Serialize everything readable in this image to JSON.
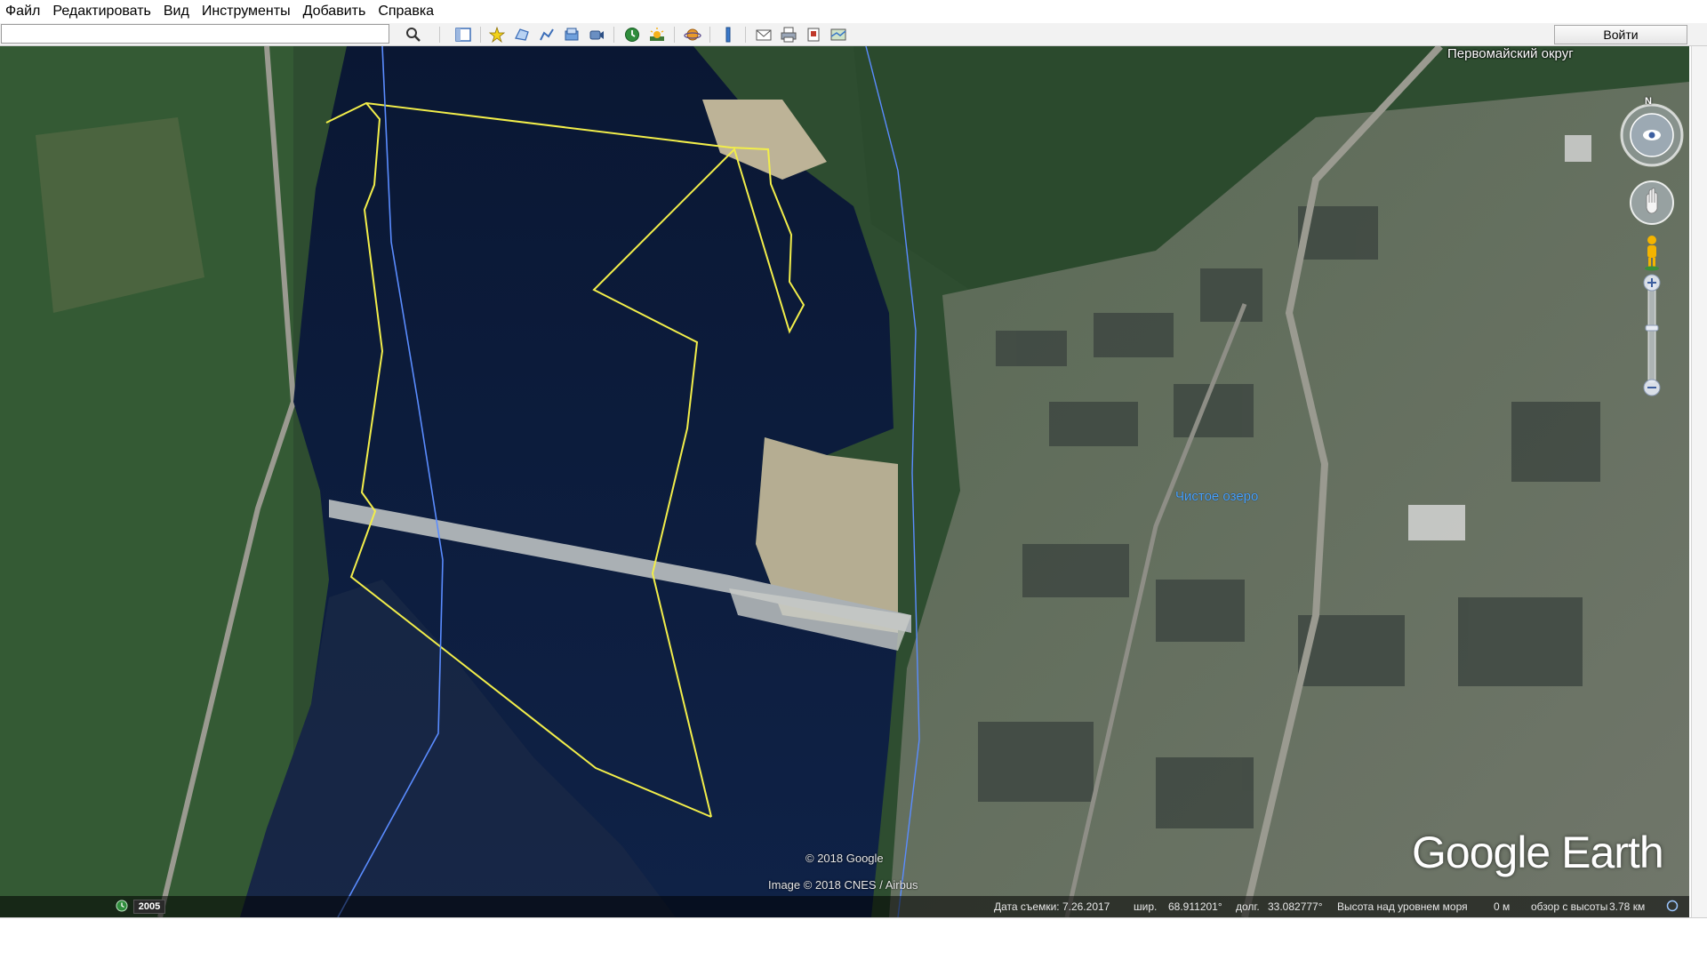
{
  "menu": {
    "items": [
      "Файл",
      "Редактировать",
      "Вид",
      "Инструменты",
      "Добавить",
      "Справка"
    ]
  },
  "toolbar": {
    "search_value": "",
    "login_label": "Войти",
    "icons": [
      "search-icon",
      "sidebar-icon",
      "placemark-icon",
      "polygon-icon",
      "path-icon",
      "overlay-icon",
      "tour-icon",
      "history-icon",
      "sun-icon",
      "planet-icon",
      "ruler-icon",
      "email-icon",
      "print-icon",
      "save-image-icon",
      "maps-icon"
    ]
  },
  "map": {
    "labels": {
      "district": "Первомайский округ",
      "lake": "Чистое озеро"
    },
    "copyright": "© 2018 Google",
    "image_credit": "Image © 2018 CNES / Airbus",
    "logo": "Google Earth",
    "colors": {
      "water": "#0b1a3a",
      "forest": "#2f5131",
      "path_yellow": "#f2ee4a",
      "border_blue": "#5a8cff"
    }
  },
  "status": {
    "year_badge": "2005",
    "capture_date": "Дата съемки: 7.26.2017",
    "lat_label": "шир.",
    "lat_value": "68.911201°",
    "lon_label": "долг.",
    "lon_value": "33.082777°",
    "elevation_label": "Высота над уровнем моря",
    "elevation_value": "0 м",
    "eye_alt_label": "обзор с высоты",
    "eye_alt_value": "3.78 км"
  },
  "nav": {
    "compass_letter": "N"
  }
}
